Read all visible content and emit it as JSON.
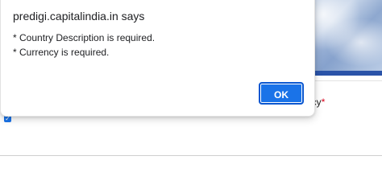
{
  "background_page": {
    "field_label": "ncy",
    "required_marker": "*",
    "checkbox_checked": true
  },
  "dialog": {
    "title": "predigi.capitalindia.in says",
    "messages": [
      "* Country Description is required.",
      "* Currency is required."
    ],
    "ok_label": "OK"
  },
  "colors": {
    "accent": "#1a73e8",
    "banner_bar": "#2a53a8",
    "required": "#d9001b"
  }
}
